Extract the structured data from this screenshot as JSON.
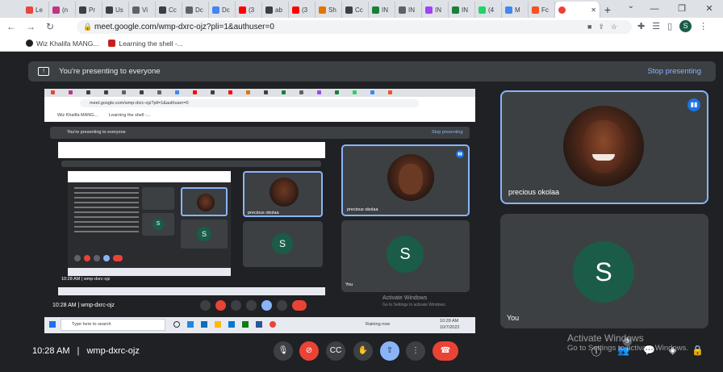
{
  "browser": {
    "tabs": [
      {
        "label": "Le",
        "color": "#e8453c"
      },
      {
        "label": "(n",
        "color": "#c13584"
      },
      {
        "label": "Pr",
        "color": "#3c4043"
      },
      {
        "label": "Us",
        "color": "#3c4043"
      },
      {
        "label": "Vi",
        "color": "#5f6368"
      },
      {
        "label": "Cc",
        "color": "#3c4043"
      },
      {
        "label": "Dc",
        "color": "#5f6368"
      },
      {
        "label": "Dc",
        "color": "#4285f4"
      },
      {
        "label": "(3",
        "color": "#ff0000"
      },
      {
        "label": "ab",
        "color": "#3c4043"
      },
      {
        "label": "(3",
        "color": "#ff0000"
      },
      {
        "label": "Sh",
        "color": "#e37400"
      },
      {
        "label": "Cc",
        "color": "#3c4043"
      },
      {
        "label": "IN",
        "color": "#188038"
      },
      {
        "label": "IN",
        "color": "#5f6368"
      },
      {
        "label": "IN",
        "color": "#a142f4"
      },
      {
        "label": "IN",
        "color": "#188038"
      },
      {
        "label": "(4",
        "color": "#25d366"
      },
      {
        "label": "M",
        "color": "#4285f4"
      },
      {
        "label": "Fc",
        "color": "#f4511e"
      }
    ],
    "active_tab_color": "#ea4335",
    "new_tab": "+",
    "url": "meet.google.com/wmp-dxrc-ojz?pli=1&authuser=0",
    "profile_initial": "S",
    "bookmarks": [
      "Wiz Khalifa MANG...",
      "Learning the shell -..."
    ]
  },
  "meet": {
    "presenting_text": "You're presenting to everyone",
    "stop_presenting": "Stop presenting",
    "participants": [
      {
        "name": "precious okolaa",
        "speaking": true
      },
      {
        "name": "You",
        "initial": "S"
      }
    ],
    "clock": "10:28 AM",
    "separator": "|",
    "meeting_code": "wmp-dxrc-ojz",
    "watermark_title": "Activate Windows",
    "watermark_sub": "Go to Settings to activate Windows.",
    "participant_count": "3"
  },
  "nested": {
    "url": "meet.google.com/wmp-dxrc-ojz?pli=1&authuser=0",
    "bookmarks": [
      "Wiz Khalifa MANG...",
      "Learning the shell -..."
    ],
    "presenting_text": "You're presenting to everyone",
    "stop_presenting": "Stop presenting",
    "tile_name": "precious okolaa",
    "you_label": "You",
    "initial": "S",
    "clock_line": "10:28 AM  |  wmp-dxrc-ojz",
    "watermark_title": "Activate Windows",
    "watermark_sub": "Go to Settings to activate Windows.",
    "search_placeholder": "Type here to search",
    "weather": "Raining now",
    "tray_time": "10:28 AM",
    "tray_date": "10/7/2022"
  }
}
